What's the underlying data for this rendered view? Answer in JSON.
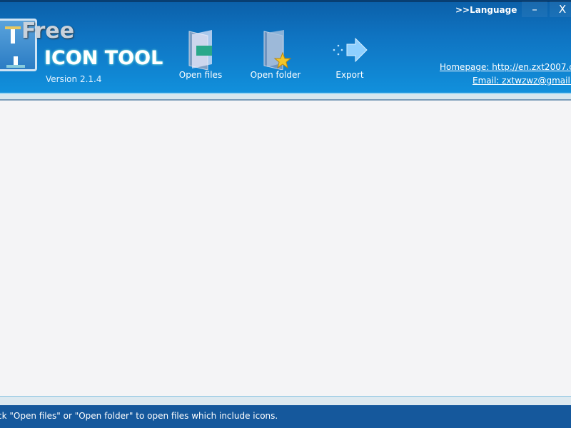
{
  "app": {
    "logo_free": "Free",
    "title": "ICON TOOL",
    "version": "Version 2.1.4"
  },
  "toolbar": [
    {
      "label": "Open files",
      "icon": "open-files-icon"
    },
    {
      "label": "Open folder",
      "icon": "open-folder-icon"
    },
    {
      "label": "Export",
      "icon": "export-arrow-icon"
    }
  ],
  "window": {
    "language": ">>Language",
    "minimize": "–",
    "close": "X"
  },
  "links": {
    "homepage": "Homepage: http://en.zxt2007.co",
    "email": "Email: zxtwzwz@gmail.co"
  },
  "status": {
    "text": "ck \"Open files\" or \"Open folder\" to open files which include icons."
  },
  "colors": {
    "header": "#1190dc",
    "status_bar": "#15589c",
    "content": "#f4f4f6"
  }
}
